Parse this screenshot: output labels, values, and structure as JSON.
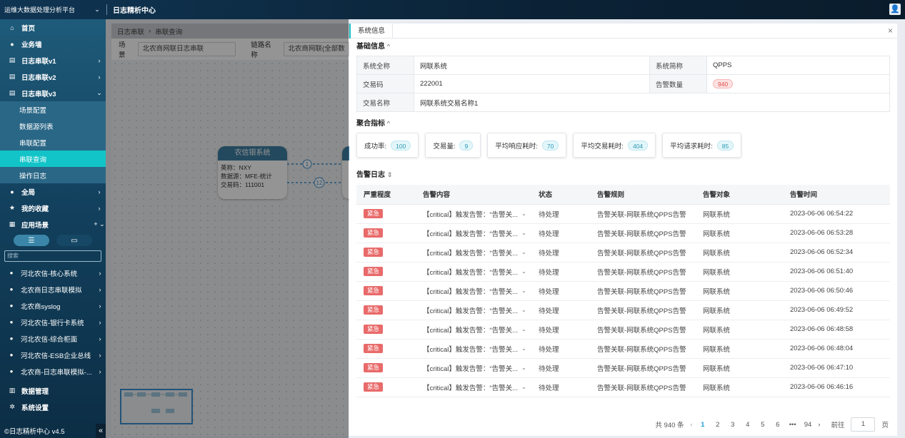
{
  "header": {
    "platform": "运维大数据处理分析平台",
    "module": "日志精析中心",
    "user_icon": "user-icon"
  },
  "sidebar": {
    "items": [
      {
        "icon": "home-icon",
        "glyph": "⌂",
        "label": "首页",
        "arrow": ""
      },
      {
        "icon": "wall-icon",
        "glyph": "●",
        "label": "业务墙",
        "arrow": ""
      },
      {
        "icon": "log-icon",
        "glyph": "▤",
        "label": "日志串联v1",
        "arrow": "›"
      },
      {
        "icon": "log-icon",
        "glyph": "▤",
        "label": "日志串联v2",
        "arrow": "›"
      },
      {
        "icon": "log-icon",
        "glyph": "▤",
        "label": "日志串联v3",
        "arrow": "⌄"
      }
    ],
    "subitems": [
      {
        "label": "场景配置",
        "active": false
      },
      {
        "label": "数据源列表",
        "active": false
      },
      {
        "label": "串联配置",
        "active": false
      },
      {
        "label": "串联查询",
        "active": true
      },
      {
        "label": "操作日志",
        "active": false
      }
    ],
    "items2": [
      {
        "icon": "global-icon",
        "glyph": "●",
        "label": "全局",
        "arrow": "›"
      },
      {
        "icon": "star-icon",
        "glyph": "★",
        "label": "我的收藏",
        "arrow": "›"
      },
      {
        "icon": "grid-icon",
        "glyph": "▦",
        "label": "应用场景",
        "arrow": "+ ⌄"
      }
    ],
    "search_placeholder": "搜索",
    "scenes": [
      {
        "label": "河北农信-核心系统"
      },
      {
        "label": "北农商日志串联模拟"
      },
      {
        "label": "北农商syslog"
      },
      {
        "label": "河北农信-银行卡系统"
      },
      {
        "label": "河北农信-综合柜面"
      },
      {
        "label": "河北农信-ESB企业总线"
      },
      {
        "label": "北农商-日志串联模拟-..."
      }
    ],
    "bottom_items": [
      {
        "icon": "data-icon",
        "glyph": "▥",
        "label": "数据管理"
      },
      {
        "icon": "gear-icon",
        "glyph": "✲",
        "label": "系统设置"
      }
    ],
    "version": "©日志精析中心 v4.5",
    "collapse": "«"
  },
  "main": {
    "breadcrumb": [
      "日志串联",
      "串联查询"
    ],
    "breadcrumb_sep": "›",
    "filter": {
      "scene_label": "场景",
      "scene_value": "北农商网联日志串联",
      "link_label": "链路名称",
      "link_value": "北农商网联(全部数"
    },
    "node": {
      "title": "农信银系统",
      "lines": [
        "英称：NXY",
        "数据源：MFE-统计",
        "交易码：111001"
      ]
    },
    "edges": [
      "1",
      "12"
    ]
  },
  "drawer": {
    "tab": "系统信息",
    "close": "×",
    "basic_title": "基础信息",
    "basic": {
      "full_name_label": "系统全称",
      "full_name": "网联系统",
      "short_name_label": "系统简称",
      "short_name": "QPPS",
      "trade_code_label": "交易码",
      "trade_code": "222001",
      "alarm_count_label": "告警数量",
      "alarm_count": "940",
      "trade_name_label": "交易名称",
      "trade_name": "网联系统交易名称1"
    },
    "metrics_title": "聚合指标",
    "metrics": [
      {
        "label": "成功率:",
        "value": "100"
      },
      {
        "label": "交易量:",
        "value": "9"
      },
      {
        "label": "平均响应耗时:",
        "value": "70"
      },
      {
        "label": "平均交易耗时:",
        "value": "404"
      },
      {
        "label": "平均请求耗时:",
        "value": "85"
      }
    ],
    "alarms_title": "告警日志",
    "alarm_columns": [
      "严重程度",
      "告警内容",
      "状态",
      "告警规则",
      "告警对象",
      "告警时间"
    ],
    "alarms": [
      {
        "severity": "紧急",
        "content": "【critical】触发告警：“告警关...",
        "status": "待处理",
        "rule": "告警关联-网联系统QPPS告警",
        "object": "网联系统",
        "time": "2023-06-06 06:54:22"
      },
      {
        "severity": "紧急",
        "content": "【critical】触发告警：“告警关...",
        "status": "待处理",
        "rule": "告警关联-网联系统QPPS告警",
        "object": "网联系统",
        "time": "2023-06-06 06:53:28"
      },
      {
        "severity": "紧急",
        "content": "【critical】触发告警：“告警关...",
        "status": "待处理",
        "rule": "告警关联-网联系统QPPS告警",
        "object": "网联系统",
        "time": "2023-06-06 06:52:34"
      },
      {
        "severity": "紧急",
        "content": "【critical】触发告警：“告警关...",
        "status": "待处理",
        "rule": "告警关联-网联系统QPPS告警",
        "object": "网联系统",
        "time": "2023-06-06 06:51:40"
      },
      {
        "severity": "紧急",
        "content": "【critical】触发告警：“告警关...",
        "status": "待处理",
        "rule": "告警关联-网联系统QPPS告警",
        "object": "网联系统",
        "time": "2023-06-06 06:50:46"
      },
      {
        "severity": "紧急",
        "content": "【critical】触发告警：“告警关...",
        "status": "待处理",
        "rule": "告警关联-网联系统QPPS告警",
        "object": "网联系统",
        "time": "2023-06-06 06:49:52"
      },
      {
        "severity": "紧急",
        "content": "【critical】触发告警：“告警关...",
        "status": "待处理",
        "rule": "告警关联-网联系统QPPS告警",
        "object": "网联系统",
        "time": "2023-06-06 06:48:58"
      },
      {
        "severity": "紧急",
        "content": "【critical】触发告警：“告警关...",
        "status": "待处理",
        "rule": "告警关联-网联系统QPPS告警",
        "object": "网联系统",
        "time": "2023-06-06 06:48:04"
      },
      {
        "severity": "紧急",
        "content": "【critical】触发告警：“告警关...",
        "status": "待处理",
        "rule": "告警关联-网联系统QPPS告警",
        "object": "网联系统",
        "time": "2023-06-06 06:47:10"
      },
      {
        "severity": "紧急",
        "content": "【critical】触发告警：“告警关...",
        "status": "待处理",
        "rule": "告警关联-网联系统QPPS告警",
        "object": "网联系统",
        "time": "2023-06-06 06:46:16"
      }
    ],
    "pager": {
      "total": "共 940 条",
      "pages": [
        "1",
        "2",
        "3",
        "4",
        "5",
        "6",
        "•••",
        "94"
      ],
      "current": "1",
      "prev": "‹",
      "next": "›",
      "goto_label": "前往",
      "goto_value": "1",
      "page_unit": "页"
    }
  }
}
